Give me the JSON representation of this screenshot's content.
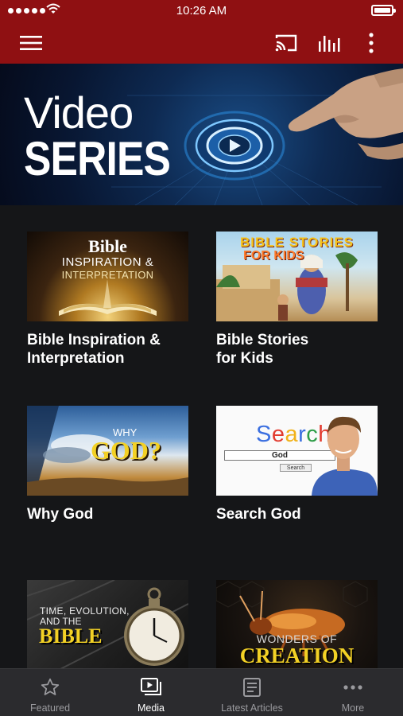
{
  "status_bar": {
    "time": "10:26 AM"
  },
  "banner": {
    "title_line1": "Video",
    "title_line2": "SERIES"
  },
  "series": [
    {
      "title": "Bible Inspiration & Interpretation",
      "title_lines": [
        "Bible Inspiration &",
        "Interpretation"
      ],
      "thumb_text": [
        "Bible",
        "INSPIRATION &",
        "INTERPRETATION"
      ]
    },
    {
      "title": "Bible Stories for Kids",
      "title_lines": [
        "Bible Stories",
        "for Kids"
      ],
      "thumb_text": [
        "BIBLE STORIES",
        "FOR KIDS"
      ]
    },
    {
      "title": "Why God",
      "title_lines": [
        "Why God",
        ""
      ],
      "thumb_text": [
        "WHY",
        "GOD?"
      ]
    },
    {
      "title": "Search God",
      "title_lines": [
        "Search God",
        ""
      ],
      "thumb_text": [
        "Search",
        "God",
        "Search"
      ]
    },
    {
      "title": "Time, Evolution, and the Bible",
      "title_lines": [
        "",
        ""
      ],
      "thumb_text": [
        "TIME, EVOLUTION,",
        "AND THE",
        "BIBLE"
      ]
    },
    {
      "title": "Wonders of Creation",
      "title_lines": [
        "",
        ""
      ],
      "thumb_text": [
        "WONDERS OF",
        "CREATION"
      ]
    }
  ],
  "tabs": [
    {
      "label": "Featured",
      "icon": "star-icon",
      "active": false
    },
    {
      "label": "Media",
      "icon": "video-library-icon",
      "active": true
    },
    {
      "label": "Latest Articles",
      "icon": "article-icon",
      "active": false
    },
    {
      "label": "More",
      "icon": "ellipsis-icon",
      "active": false
    }
  ],
  "colors": {
    "brand_red": "#8f1012",
    "background": "#151618",
    "tab_bar": "#2b2b2e",
    "tab_inactive": "#9a9a9e"
  }
}
